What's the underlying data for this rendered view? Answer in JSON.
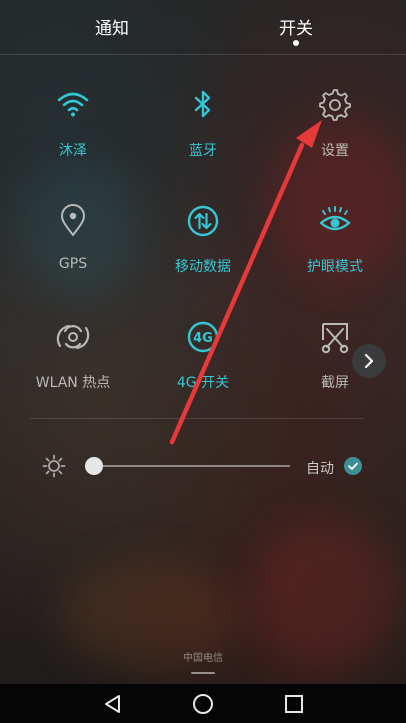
{
  "tabs": {
    "notify_label": "通知",
    "switch_label": "开关",
    "active": "开关"
  },
  "toggles": [
    {
      "label": "沐泽",
      "icon": "wifi-icon",
      "active": true
    },
    {
      "label": "蓝牙",
      "icon": "bluetooth-icon",
      "active": true
    },
    {
      "label": "设置",
      "icon": "gear-icon",
      "active": false
    },
    {
      "label": "GPS",
      "icon": "location-pin-icon",
      "active": false
    },
    {
      "label": "移动数据",
      "icon": "mobile-data-icon",
      "active": true
    },
    {
      "label": "护眼模式",
      "icon": "eye-icon",
      "active": true
    },
    {
      "label": "WLAN 热点",
      "icon": "hotspot-icon",
      "active": false
    },
    {
      "label": "4G 开关",
      "icon": "4g-icon",
      "active": true,
      "icon_text": "4G"
    },
    {
      "label": "截屏",
      "icon": "screenshot-icon",
      "active": false
    }
  ],
  "brightness": {
    "auto_label": "自动",
    "auto_checked": true,
    "level": 0.0
  },
  "carrier": "中国电信",
  "colors": {
    "accent": "#34c6d3",
    "inactive": "#b9b9b9",
    "annotation_arrow": "#e8393a"
  }
}
